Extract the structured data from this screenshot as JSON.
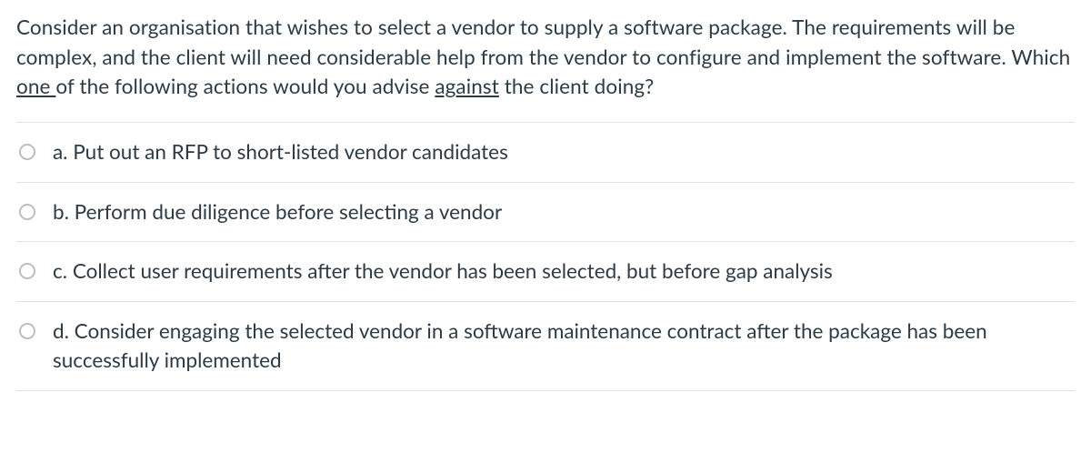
{
  "question": {
    "part1": "Consider an organisation that wishes to select a vendor to supply a software package. The requirements will be complex, and the client will need considerable help from the vendor to configure and implement the software. Which ",
    "underlined1": "one ",
    "part2": "of the following actions would you advise ",
    "underlined2": "against",
    "part3": " the client doing?"
  },
  "options": [
    {
      "label": "a. Put out an RFP to short-listed vendor candidates"
    },
    {
      "label": "b. Perform due diligence before selecting a vendor"
    },
    {
      "label": "c. Collect user requirements after the vendor has been selected, but before gap analysis"
    },
    {
      "label": "d. Consider engaging the selected vendor in a software maintenance contract after the package has been successfully implemented"
    }
  ]
}
